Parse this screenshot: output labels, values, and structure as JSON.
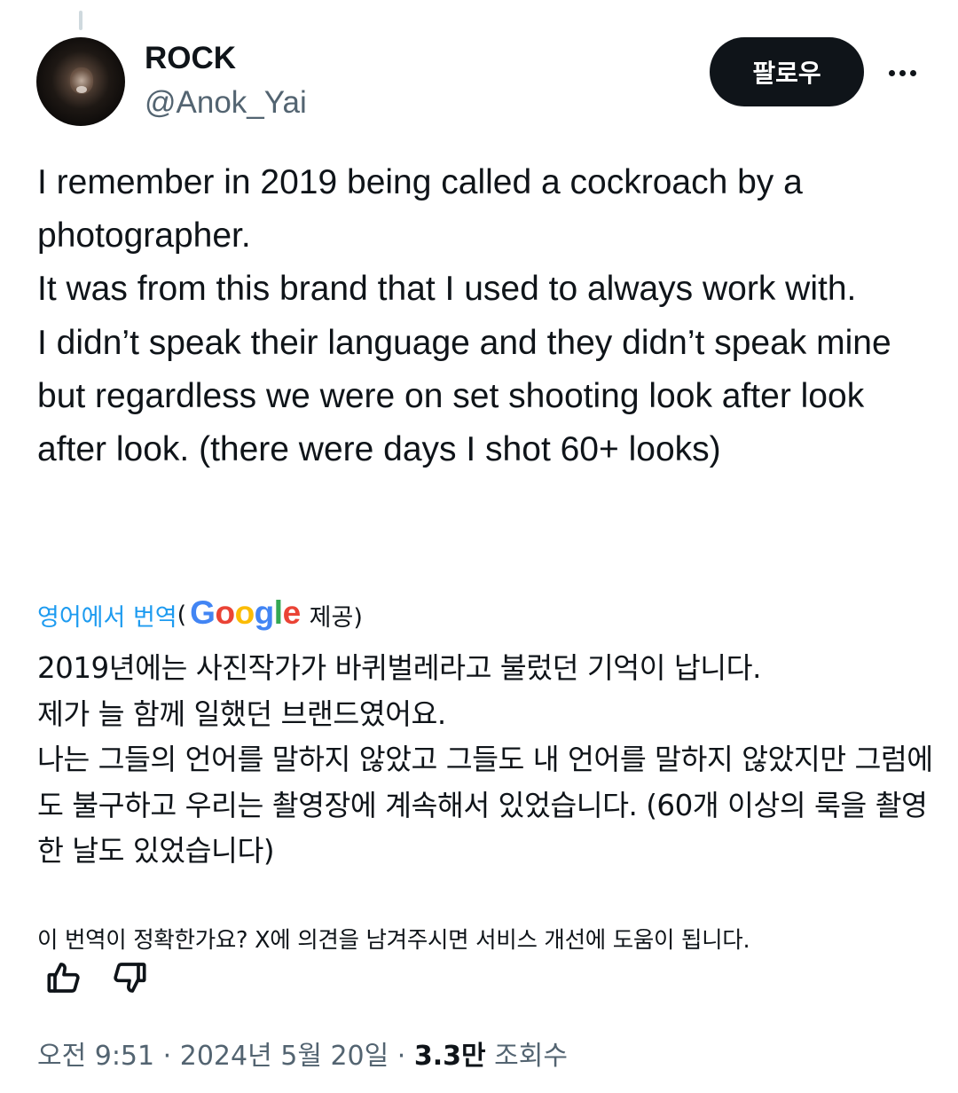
{
  "author": {
    "display_name": "ROCK",
    "handle": "@Anok_Yai"
  },
  "header": {
    "follow_label": "팔로우"
  },
  "tweet": {
    "text_lines": [
      "I remember in 2019 being called a cockroach by a photographer.",
      "It was from this brand that I used to always work with.",
      "I didn’t speak their language and they didn’t speak mine but regardless we were on set shooting look after look after look. (there were days I shot 60+ looks)"
    ]
  },
  "translation": {
    "link_label": "영어에서 번역",
    "open_paren": "(",
    "google_logo_text": "Google",
    "provided_label": "제공)",
    "text_lines": [
      "2019년에는 사진작가가 바퀴벌레라고 불렀던 기억이 납니다.",
      "제가 늘 함께 일했던 브랜드였어요.",
      "나는 그들의 언어를 말하지 않았고 그들도 내 언어를 말하지 않았지만 그럼에도 불구하고 우리는 촬영장에 계속해서 있었습니다. (60개 이상의 룩을 촬영한 날도 있었습니다)"
    ],
    "feedback_question": "이 번역이 정확한가요? X에 의견을 남겨주시면 서비스 개선에 도움이 됩니다."
  },
  "meta": {
    "time": "오전 9:51",
    "separator": "·",
    "date": "2024년 5월 20일",
    "views_count": "3.3만",
    "views_label": "조회수"
  },
  "icons": {
    "more": "more-horizontal-icon",
    "thumb_up": "thumbs-up-icon",
    "thumb_down": "thumbs-down-icon",
    "google": "google-logo"
  },
  "colors": {
    "accent": "#1d9bf0",
    "text_primary": "#0f1419",
    "text_secondary": "#536471",
    "follow_button_bg": "#0f1419"
  }
}
